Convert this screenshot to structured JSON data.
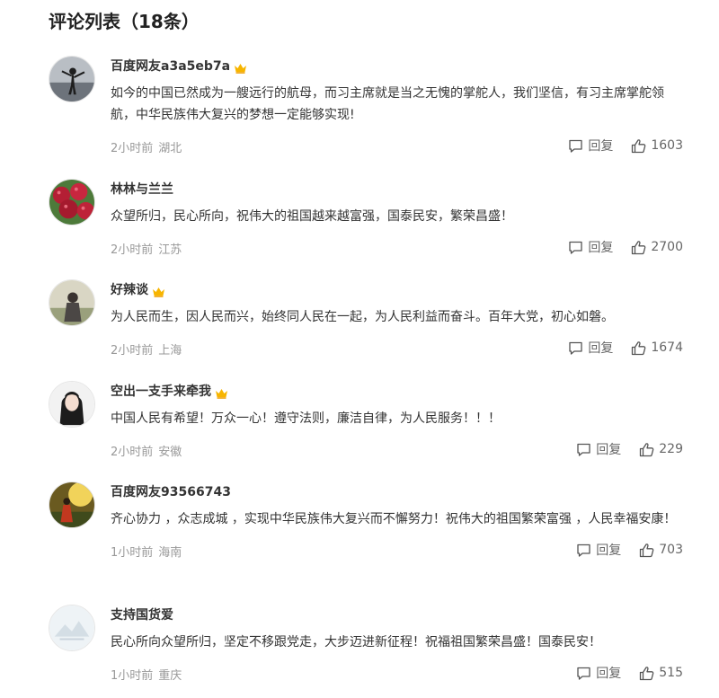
{
  "page": {
    "title": "评论列表（18条）"
  },
  "ui": {
    "reply_label": "回复"
  },
  "colors": {
    "crown": "#f7b500",
    "meta": "#999999",
    "text": "#333333"
  },
  "comments": [
    {
      "username": "百度网友a3a5eb7a",
      "vip": true,
      "avatar": "silhouette-person",
      "content": "如今的中国已然成为一艘远行的航母，而习主席就是当之无愧的掌舵人，我们坚信，有习主席掌舵领航，中华民族伟大复兴的梦想一定能够实现!",
      "time": "2小时前",
      "location": "湖北",
      "likes": "1603"
    },
    {
      "username": "林林与兰兰",
      "vip": false,
      "avatar": "red-berries",
      "content": "众望所归，民心所向，祝伟大的祖国越来越富强，国泰民安，繁荣昌盛！",
      "time": "2小时前",
      "location": "江苏",
      "likes": "2700"
    },
    {
      "username": "好辣谈",
      "vip": true,
      "avatar": "girl-outdoor",
      "content": "为人民而生，因人民而兴，始终同人民在一起，为人民利益而奋斗。百年大党，初心如磐。",
      "time": "2小时前",
      "location": "上海",
      "likes": "1674"
    },
    {
      "username": "空出一支手来牵我",
      "vip": true,
      "avatar": "girl-portrait",
      "content": "中国人民有希望！万众一心！遵守法则，廉洁自律，为人民服务！！！",
      "time": "2小时前",
      "location": "安徽",
      "likes": "229"
    },
    {
      "username": "百度网友93566743",
      "vip": false,
      "avatar": "sunset-figure",
      "content": "齐心协力 ，众志成城 ，实现中华民族伟大复兴而不懈努力！祝伟大的祖国繁荣富强 ，人民幸福安康！",
      "time": "1小时前",
      "location": "海南",
      "likes": "703"
    },
    {
      "username": "支持国货爱",
      "vip": false,
      "avatar": "default-mountain",
      "content": "民心所向众望所归，坚定不移跟党走，大步迈进新征程！祝福祖国繁荣昌盛！国泰民安！",
      "time": "1小时前",
      "location": "重庆",
      "likes": "515"
    }
  ]
}
